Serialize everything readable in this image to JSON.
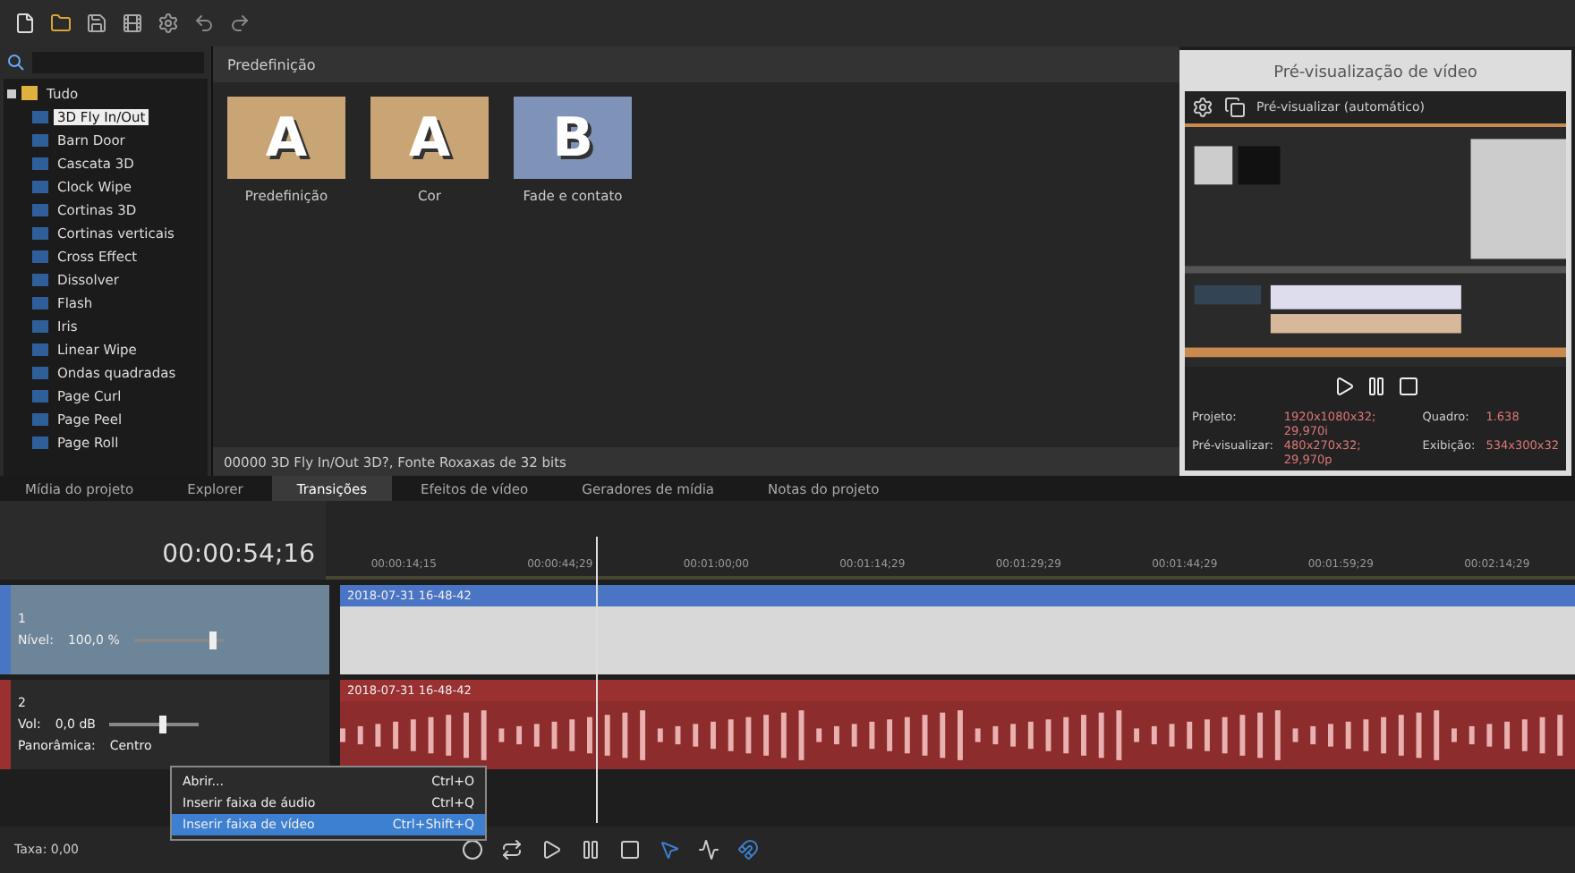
{
  "tree": {
    "root": {
      "label": "Tudo",
      "expanded": true
    },
    "items": [
      {
        "label": "3D Fly In/Out",
        "selected": true
      },
      {
        "label": "Barn Door",
        "selected": false
      },
      {
        "label": "Cascata 3D",
        "selected": false
      },
      {
        "label": "Clock Wipe",
        "selected": false
      },
      {
        "label": "Cortinas 3D",
        "selected": false
      },
      {
        "label": "Cortinas verticais",
        "selected": false
      },
      {
        "label": "Cross Effect",
        "selected": false
      },
      {
        "label": "Dissolver",
        "selected": false
      },
      {
        "label": "Flash",
        "selected": false
      },
      {
        "label": "Iris",
        "selected": false
      },
      {
        "label": "Linear Wipe",
        "selected": false
      },
      {
        "label": "Ondas quadradas",
        "selected": false
      },
      {
        "label": "Page Curl",
        "selected": false
      },
      {
        "label": "Page Peel",
        "selected": false
      },
      {
        "label": "Page Roll",
        "selected": false
      }
    ]
  },
  "presets": {
    "title": "Predefinição",
    "items": [
      {
        "letter": "A",
        "label": "Predefinição",
        "color": "#c9a474"
      },
      {
        "letter": "A",
        "label": "Cor",
        "color": "#c9a474"
      },
      {
        "letter": "B",
        "label": "Fade e contato",
        "color": "#7f93b8"
      }
    ],
    "status": "00000 3D Fly In/Out 3D?, Fonte Roxaxas de 32 bits"
  },
  "preview": {
    "title": "Pré-visualização de vídeo",
    "mode": "Pré-visualizar (automático)",
    "info": [
      {
        "label": "Projeto:",
        "value": "1920x1080x32; 29,970i",
        "label2": "Quadro:",
        "value2": "1.638"
      },
      {
        "label": "Pré-visualizar:",
        "value": "480x270x32; 29,970p",
        "label2": "Exibição:",
        "value2": "534x300x32"
      }
    ]
  },
  "tabs": [
    {
      "label": "Mídia do projeto",
      "selected": false
    },
    {
      "label": "Explorer",
      "selected": false
    },
    {
      "label": "Transições",
      "selected": true
    },
    {
      "label": "Efeitos de vídeo",
      "selected": false
    },
    {
      "label": "Geradores de mídia",
      "selected": false
    },
    {
      "label": "Notas do projeto",
      "selected": false
    }
  ],
  "timeline": {
    "timecode": "00:00:54;16",
    "ruler": [
      "00:00:14;15",
      "00:00:44;29",
      "00:01:00;00",
      "00:01:14;29",
      "00:01:29;29",
      "00:01:44;29",
      "00:01:59;29",
      "00:02:14;29"
    ],
    "tracks": [
      {
        "kind": "video",
        "number": "1",
        "label": "Nível:",
        "value": "100,0 %",
        "level": 0.92,
        "clip": "2018-07-31 16-48-42"
      },
      {
        "kind": "audio",
        "number": "2",
        "label": "Vol:",
        "value": "0,0 dB",
        "level": 0.6,
        "label2": "Panorâmica:",
        "value2": "Centro",
        "clip": "2018-07-31 16-48-42"
      }
    ]
  },
  "menu": [
    {
      "label": "Abrir...",
      "shortcut": "Ctrl+O",
      "selected": false
    },
    {
      "label": "Inserir faixa de áudio",
      "shortcut": "Ctrl+Q",
      "selected": false
    },
    {
      "label": "Inserir faixa de vídeo",
      "shortcut": "Ctrl+Shift+Q",
      "selected": true
    }
  ],
  "status_bar": {
    "rate": "Taxa: 0,00"
  }
}
